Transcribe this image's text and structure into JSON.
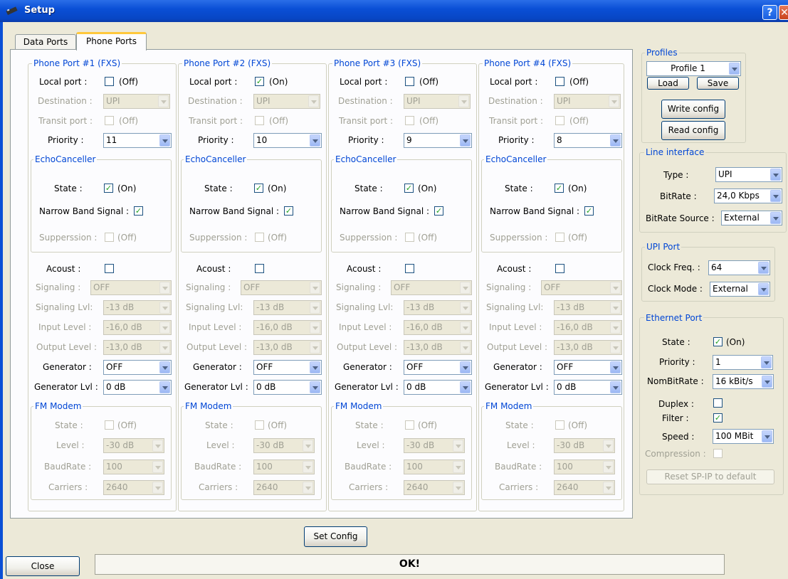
{
  "window": {
    "title": "Setup",
    "help_glyph": "?",
    "close_glyph": "✕"
  },
  "tabs": [
    {
      "label": "Data Ports",
      "active": false
    },
    {
      "label": "Phone Ports",
      "active": true
    }
  ],
  "labels": {
    "local_port": "Local port :",
    "destination": "Destination :",
    "transit_port": "Transit port :",
    "priority": "Priority :",
    "echo_title": "EchoCanceller",
    "state": "State :",
    "narrow_band": "Narrow Band Signal :",
    "suppression": "Supperssion :",
    "acoust": "Acoust :",
    "signaling": "Signaling :",
    "signaling_lvl": "Signaling Lvl:",
    "input_level": "Input Level :",
    "output_level": "Output Level :",
    "generator": "Generator :",
    "generator_lvl": "Generator Lvl :",
    "fm_title": "FM Modem",
    "level": "Level :",
    "baudrate": "BaudRate :",
    "carriers": "Carriers :"
  },
  "ports": [
    {
      "title": "Phone Port #1 (FXS)",
      "local_port": {
        "checked": false,
        "text": "(Off)"
      },
      "destination": "UPI",
      "transit_port": {
        "checked": false,
        "text": "(Off)"
      },
      "priority": "11",
      "echo": {
        "state": {
          "checked": true,
          "text": "(On)"
        },
        "narrow_band": true,
        "suppression": {
          "checked": false,
          "text": "(Off)"
        }
      },
      "acoust": false,
      "signaling": "OFF",
      "signaling_lvl": "-13 dB",
      "input_level": "-16,0 dB",
      "output_level": "-13,0 dB",
      "generator": "OFF",
      "generator_lvl": "0 dB",
      "fm": {
        "state": {
          "checked": false,
          "text": "(Off)"
        },
        "level": "-30 dB",
        "baudrate": "100",
        "carriers": "2640"
      }
    },
    {
      "title": "Phone Port #2 (FXS)",
      "local_port": {
        "checked": true,
        "text": "(On)"
      },
      "destination": "UPI",
      "transit_port": {
        "checked": false,
        "text": "(Off)"
      },
      "priority": "10",
      "echo": {
        "state": {
          "checked": true,
          "text": "(On)"
        },
        "narrow_band": true,
        "suppression": {
          "checked": false,
          "text": "(Off)"
        }
      },
      "acoust": false,
      "signaling": "OFF",
      "signaling_lvl": "-13 dB",
      "input_level": "-16,0 dB",
      "output_level": "-13,0 dB",
      "generator": "OFF",
      "generator_lvl": "0 dB",
      "fm": {
        "state": {
          "checked": false,
          "text": "(Off)"
        },
        "level": "-30 dB",
        "baudrate": "100",
        "carriers": "2640"
      }
    },
    {
      "title": "Phone Port #3 (FXS)",
      "local_port": {
        "checked": false,
        "text": "(Off)"
      },
      "destination": "UPI",
      "transit_port": {
        "checked": false,
        "text": "(Off)"
      },
      "priority": "9",
      "echo": {
        "state": {
          "checked": true,
          "text": "(On)"
        },
        "narrow_band": true,
        "suppression": {
          "checked": false,
          "text": "(Off)"
        }
      },
      "acoust": false,
      "signaling": "OFF",
      "signaling_lvl": "-13 dB",
      "input_level": "-16,0 dB",
      "output_level": "-13,0 dB",
      "generator": "OFF",
      "generator_lvl": "0 dB",
      "fm": {
        "state": {
          "checked": false,
          "text": "(Off)"
        },
        "level": "-30 dB",
        "baudrate": "100",
        "carriers": "2640"
      }
    },
    {
      "title": "Phone Port #4 (FXS)",
      "local_port": {
        "checked": false,
        "text": "(Off)"
      },
      "destination": "UPI",
      "transit_port": {
        "checked": false,
        "text": "(Off)"
      },
      "priority": "8",
      "echo": {
        "state": {
          "checked": true,
          "text": "(On)"
        },
        "narrow_band": true,
        "suppression": {
          "checked": false,
          "text": "(Off)"
        }
      },
      "acoust": false,
      "signaling": "OFF",
      "signaling_lvl": "-13 dB",
      "input_level": "-16,0 dB",
      "output_level": "-13,0 dB",
      "generator": "OFF",
      "generator_lvl": "0 dB",
      "fm": {
        "state": {
          "checked": false,
          "text": "(Off)"
        },
        "level": "-30 dB",
        "baudrate": "100",
        "carriers": "2640"
      }
    }
  ],
  "profiles": {
    "title": "Profiles",
    "selected": "Profile 1",
    "load": "Load",
    "save": "Save",
    "write_config": "Write config",
    "read_config": "Read config"
  },
  "line_interface": {
    "title": "Line interface",
    "type_label": "Type :",
    "type": "UPI",
    "bitrate_label": "BitRate :",
    "bitrate": "24,0 Kbps",
    "bitrate_source_label": "BitRate Source :",
    "bitrate_source": "External"
  },
  "upi_port": {
    "title": "UPI Port",
    "clock_freq_label": "Clock Freq. :",
    "clock_freq": "64",
    "clock_mode_label": "Clock Mode :",
    "clock_mode": "External"
  },
  "ethernet": {
    "title": "Ethernet Port",
    "state_label": "State :",
    "state": {
      "checked": true,
      "text": "(On)"
    },
    "priority_label": "Priority :",
    "priority": "1",
    "nombitrate_label": "NomBitRate :",
    "nombitrate": "16 kBit/s",
    "duplex_label": "Duplex :",
    "duplex": false,
    "filter_label": "Filter :",
    "filter": true,
    "speed_label": "Speed :",
    "speed": "100 MBit",
    "compression_label": "Compression :",
    "compression": false,
    "reset": "Reset SP-IP to default"
  },
  "bottom": {
    "set_config": "Set Config",
    "close": "Close",
    "status": "OK!"
  },
  "check_glyph": "✓"
}
